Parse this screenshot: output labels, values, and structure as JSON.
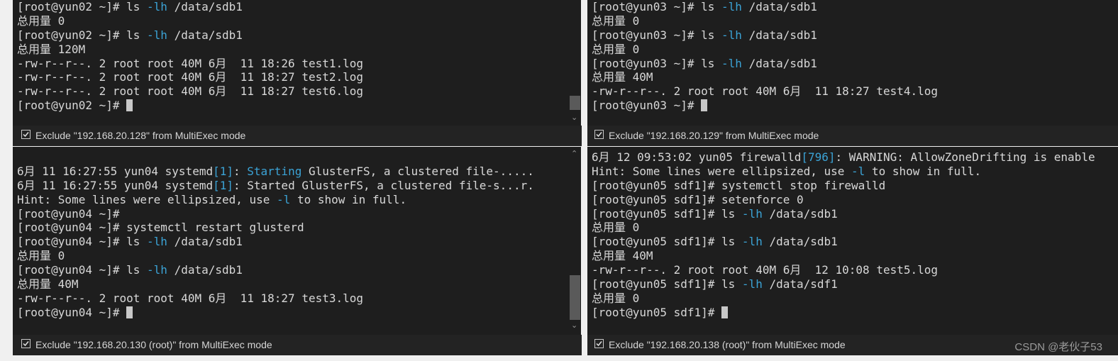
{
  "panes": [
    {
      "id": "yun02",
      "lines": [
        [
          {
            "t": "[root@yun02 ~]# ls "
          },
          {
            "t": "-lh",
            "c": "hl"
          },
          {
            "t": " /data/sdb1"
          }
        ],
        [
          {
            "t": "总用量 0"
          }
        ],
        [
          {
            "t": "[root@yun02 ~]# ls "
          },
          {
            "t": "-lh",
            "c": "hl"
          },
          {
            "t": " /data/sdb1"
          }
        ],
        [
          {
            "t": "总用量 120M"
          }
        ],
        [
          {
            "t": "-rw-r--r--. 2 root root 40M 6月  11 18:26 test1.log"
          }
        ],
        [
          {
            "t": "-rw-r--r--. 2 root root 40M 6月  11 18:27 test2.log"
          }
        ],
        [
          {
            "t": "-rw-r--r--. 2 root root 40M 6月  11 18:27 test6.log"
          }
        ],
        [
          {
            "t": "[root@yun02 ~]# "
          },
          {
            "cursor": true
          }
        ]
      ],
      "status": "Exclude \"192.168.20.128\" from MultiExec mode"
    },
    {
      "id": "yun03",
      "lines": [
        [
          {
            "t": "[root@yun03 ~]# ls "
          },
          {
            "t": "-lh",
            "c": "hl"
          },
          {
            "t": " /data/sdb1"
          }
        ],
        [
          {
            "t": "总用量 0"
          }
        ],
        [
          {
            "t": "[root@yun03 ~]# ls "
          },
          {
            "t": "-lh",
            "c": "hl"
          },
          {
            "t": " /data/sdb1"
          }
        ],
        [
          {
            "t": "总用量 0"
          }
        ],
        [
          {
            "t": "[root@yun03 ~]# ls "
          },
          {
            "t": "-lh",
            "c": "hl"
          },
          {
            "t": " /data/sdb1"
          }
        ],
        [
          {
            "t": "总用量 40M"
          }
        ],
        [
          {
            "t": "-rw-r--r--. 2 root root 40M 6月  11 18:27 test4.log"
          }
        ],
        [
          {
            "t": "[root@yun03 ~]# "
          },
          {
            "cursor": true
          }
        ]
      ],
      "status": "Exclude \"192.168.20.129\" from MultiExec mode"
    },
    {
      "id": "yun04",
      "lines": [
        [
          {
            "t": ""
          }
        ],
        [
          {
            "t": "6月 11 16:27:55 yun04 systemd"
          },
          {
            "t": "[1]",
            "c": "hl"
          },
          {
            "t": ": "
          },
          {
            "t": "Starting",
            "c": "hl"
          },
          {
            "t": " GlusterFS, a clustered file-....."
          }
        ],
        [
          {
            "t": "6月 11 16:27:55 yun04 systemd"
          },
          {
            "t": "[1]",
            "c": "hl"
          },
          {
            "t": ": Started GlusterFS, a clustered file-s...r."
          }
        ],
        [
          {
            "t": "Hint: Some lines were ellipsized, use "
          },
          {
            "t": "-l",
            "c": "hl"
          },
          {
            "t": " to show in full."
          }
        ],
        [
          {
            "t": "[root@yun04 ~]#"
          }
        ],
        [
          {
            "t": "[root@yun04 ~]# systemctl restart glusterd"
          }
        ],
        [
          {
            "t": "[root@yun04 ~]# ls "
          },
          {
            "t": "-lh",
            "c": "hl"
          },
          {
            "t": " /data/sdb1"
          }
        ],
        [
          {
            "t": "总用量 0"
          }
        ],
        [
          {
            "t": "[root@yun04 ~]# ls "
          },
          {
            "t": "-lh",
            "c": "hl"
          },
          {
            "t": " /data/sdb1"
          }
        ],
        [
          {
            "t": "总用量 40M"
          }
        ],
        [
          {
            "t": "-rw-r--r--. 2 root root 40M 6月  11 18:27 test3.log"
          }
        ],
        [
          {
            "t": "[root@yun04 ~]# "
          },
          {
            "cursor": true
          }
        ]
      ],
      "status": "Exclude \"192.168.20.130 (root)\" from MultiExec mode"
    },
    {
      "id": "yun05",
      "lines": [
        [
          {
            "t": "6月 12 09:53:02 yun05 firewalld"
          },
          {
            "t": "[796]",
            "c": "hl"
          },
          {
            "t": ": WARNING: AllowZoneDrifting is enable"
          }
        ],
        [
          {
            "t": "Hint: Some lines were ellipsized, use "
          },
          {
            "t": "-l",
            "c": "hl"
          },
          {
            "t": " to show in full."
          }
        ],
        [
          {
            "t": "[root@yun05 sdf1]# systemctl stop firewalld"
          }
        ],
        [
          {
            "t": "[root@yun05 sdf1]# setenforce 0"
          }
        ],
        [
          {
            "t": "[root@yun05 sdf1]# ls "
          },
          {
            "t": "-lh",
            "c": "hl"
          },
          {
            "t": " /data/sdb1"
          }
        ],
        [
          {
            "t": "总用量 0"
          }
        ],
        [
          {
            "t": "[root@yun05 sdf1]# ls "
          },
          {
            "t": "-lh",
            "c": "hl"
          },
          {
            "t": " /data/sdb1"
          }
        ],
        [
          {
            "t": "总用量 40M"
          }
        ],
        [
          {
            "t": "-rw-r--r--. 2 root root 40M 6月  12 10:08 test5.log"
          }
        ],
        [
          {
            "t": "[root@yun05 sdf1]# ls "
          },
          {
            "t": "-lh",
            "c": "hl"
          },
          {
            "t": " /data/sdf1"
          }
        ],
        [
          {
            "t": "总用量 0"
          }
        ],
        [
          {
            "t": "[root@yun05 sdf1]# "
          },
          {
            "cursor": true
          }
        ]
      ],
      "status": "Exclude \"192.168.20.138 (root)\" from MultiExec mode"
    }
  ],
  "watermark": "CSDN @老伙子53"
}
